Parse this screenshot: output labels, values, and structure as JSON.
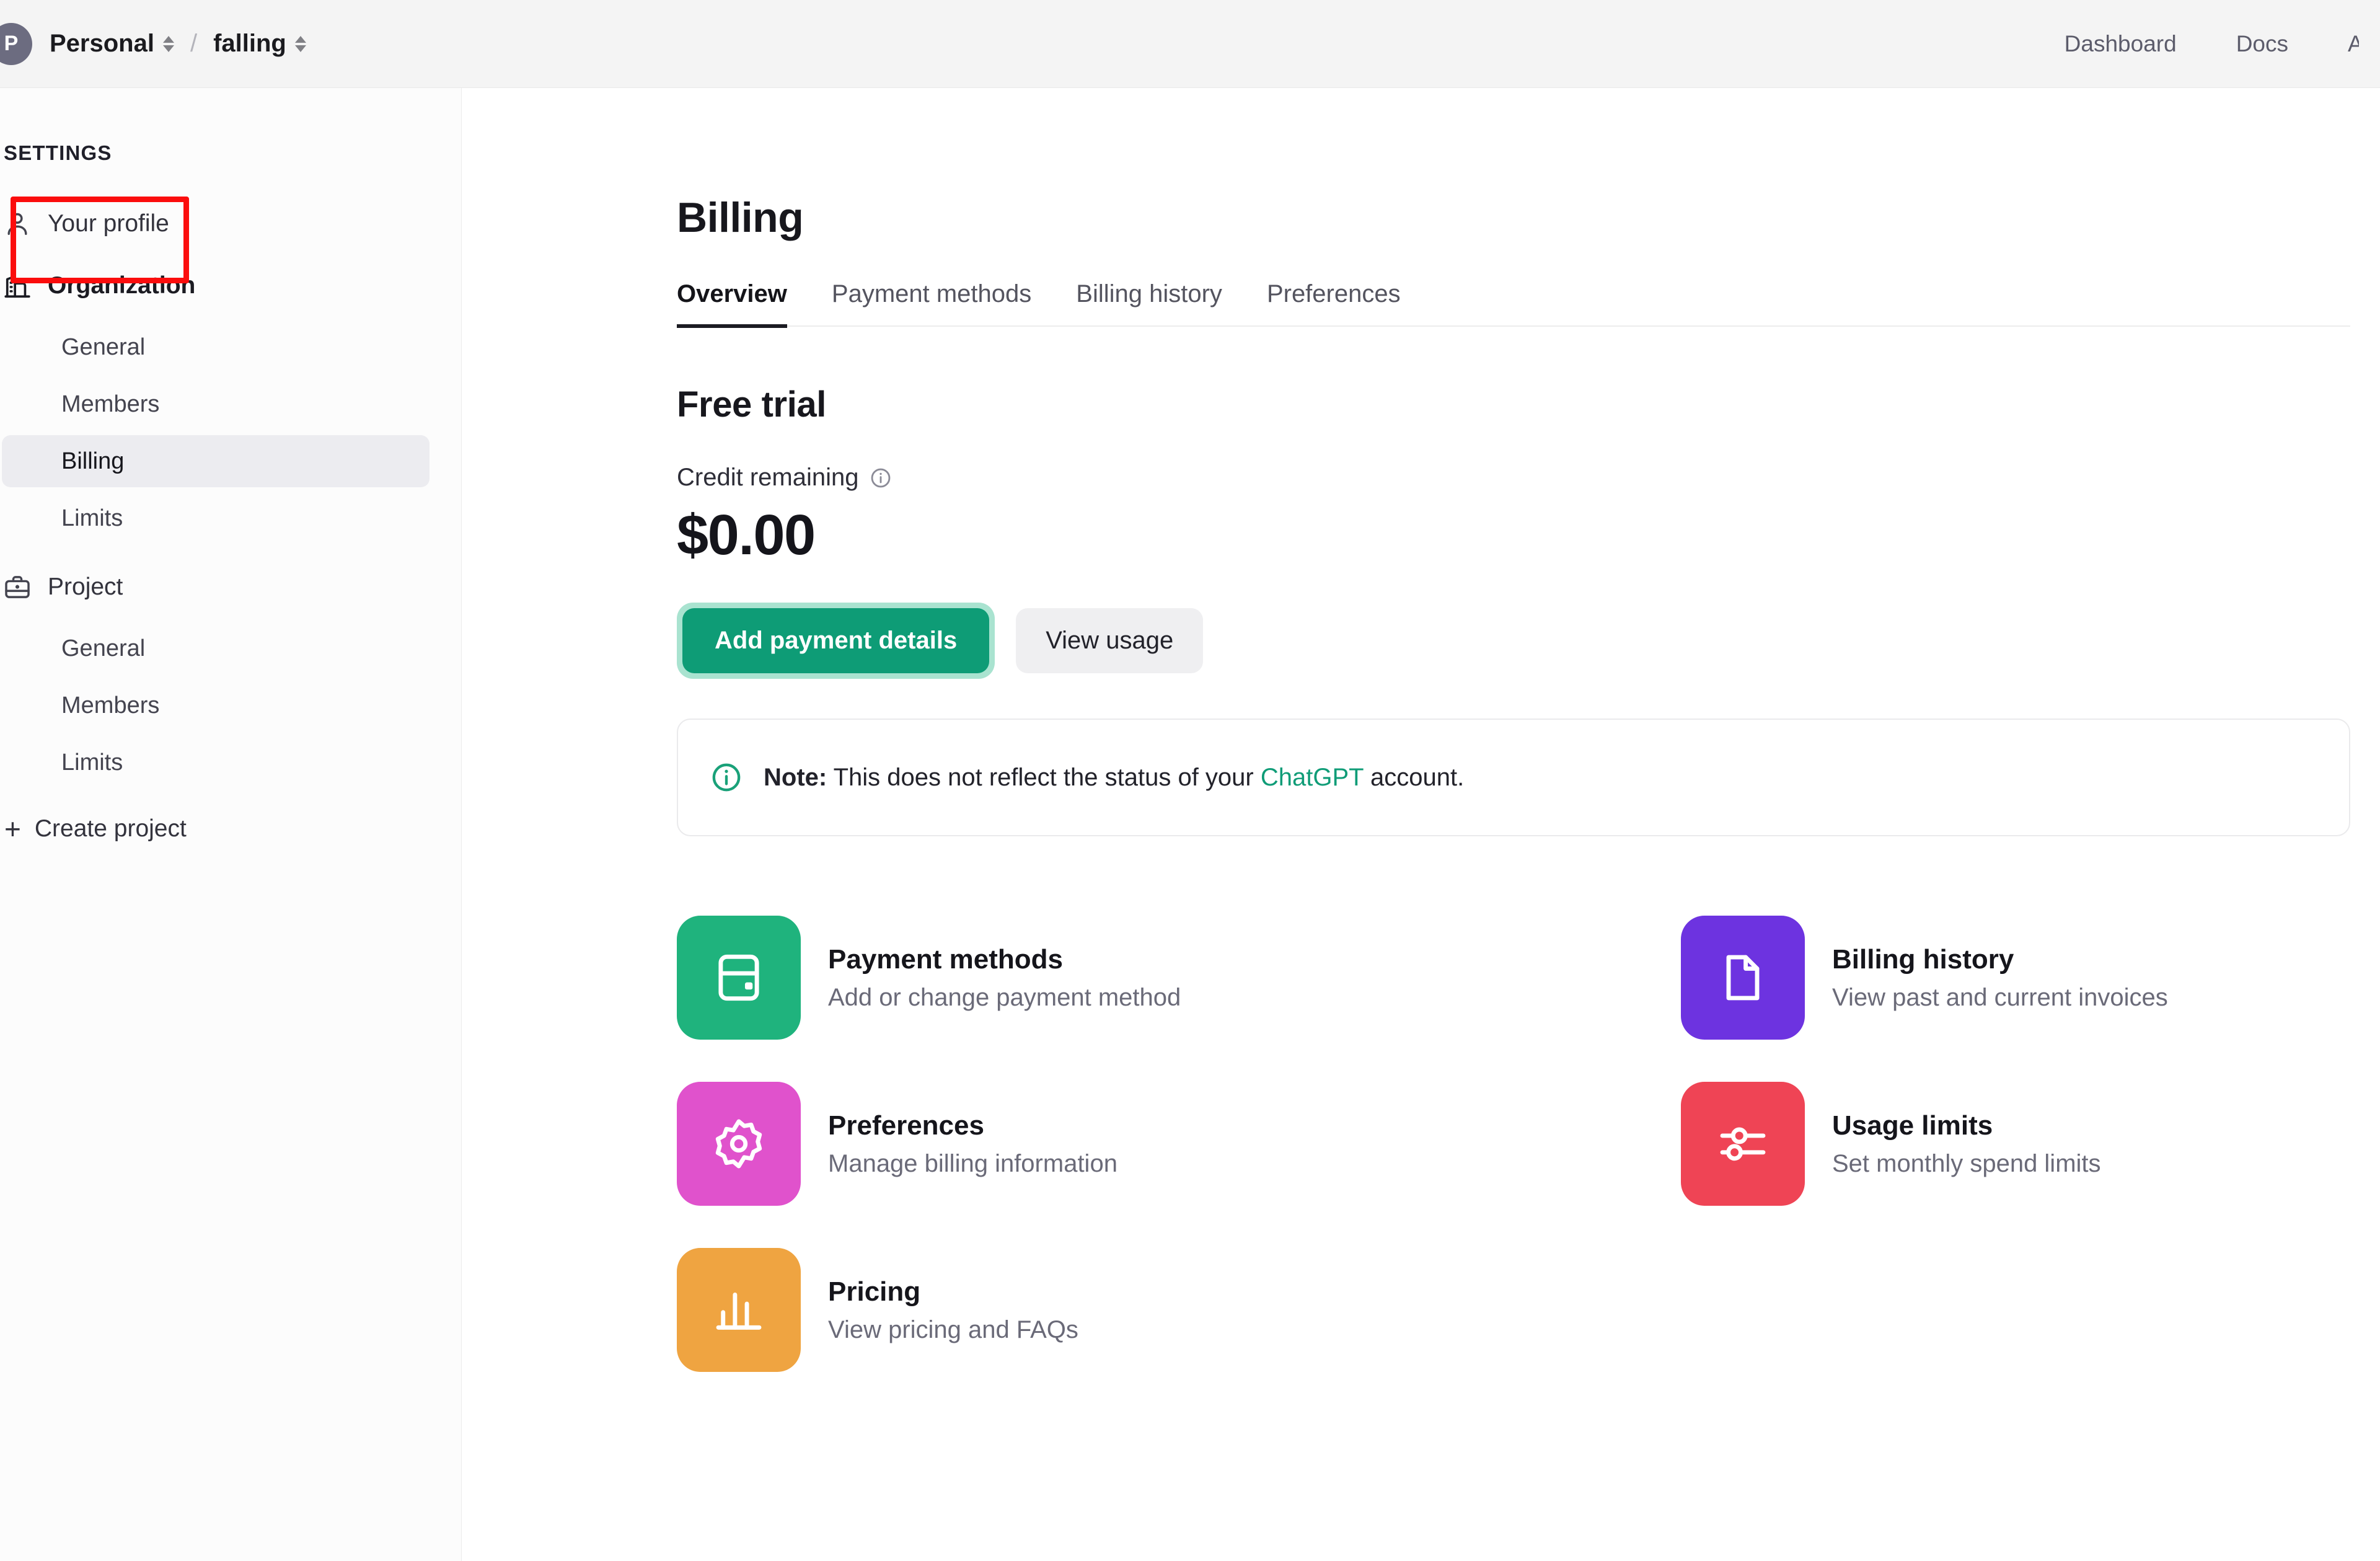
{
  "topbar": {
    "avatar_initial": "P",
    "org_name": "Personal",
    "separator": "/",
    "project_name": "falling",
    "nav": [
      {
        "label": "Dashboard",
        "name": "dashboard"
      },
      {
        "label": "Docs",
        "name": "docs"
      }
    ],
    "overflow_label": "A"
  },
  "sidebar": {
    "heading": "SETTINGS",
    "your_profile": {
      "label": "Your profile",
      "icon": "user-icon"
    },
    "organization": {
      "label": "Organization",
      "icon": "building-icon"
    },
    "org_items": [
      {
        "label": "General",
        "active": false
      },
      {
        "label": "Members",
        "active": false
      },
      {
        "label": "Billing",
        "active": true
      },
      {
        "label": "Limits",
        "active": false
      }
    ],
    "project": {
      "label": "Project",
      "icon": "briefcase-icon"
    },
    "project_items": [
      {
        "label": "General",
        "active": false
      },
      {
        "label": "Members",
        "active": false
      },
      {
        "label": "Limits",
        "active": false
      }
    ],
    "create_project": {
      "label": "Create project",
      "icon": "plus-icon"
    }
  },
  "main": {
    "page_title": "Billing",
    "tabs": [
      {
        "label": "Overview",
        "active": true
      },
      {
        "label": "Payment methods",
        "active": false
      },
      {
        "label": "Billing history",
        "active": false
      },
      {
        "label": "Preferences",
        "active": false
      }
    ],
    "plan_title": "Free trial",
    "credit_label": "Credit remaining",
    "credit_info_icon": "info-circle-icon",
    "credit_amount": "$0.00",
    "add_payment_label": "Add payment details",
    "view_usage_label": "View usage",
    "note": {
      "icon": "info-circle-icon",
      "bold_prefix": "Note:",
      "text_before": " This does not reflect the status of your ",
      "link": "ChatGPT",
      "text_after": " account."
    },
    "cards": [
      {
        "title": "Payment methods",
        "subtitle": "Add or change payment method",
        "icon": "credit-card-icon",
        "color": "#1fb37d"
      },
      {
        "title": "Billing history",
        "subtitle": "View past and current invoices",
        "icon": "document-icon",
        "color": "#6d33e0"
      },
      {
        "title": "Preferences",
        "subtitle": "Manage billing information",
        "icon": "gear-icon",
        "color": "#e052cc"
      },
      {
        "title": "Usage limits",
        "subtitle": "Set monthly spend limits",
        "icon": "sliders-icon",
        "color": "#ef4455"
      },
      {
        "title": "Pricing",
        "subtitle": "View pricing and FAQs",
        "icon": "bar-chart-icon",
        "color": "#efa441"
      }
    ]
  },
  "annotation": {
    "target": "Billing",
    "color": "#fb0d0d"
  },
  "colors": {
    "accent_green": "#0e9c76",
    "link_green": "#0f9c77",
    "annotation_red": "#fb0d0d",
    "topbar_bg": "#f4f4f4",
    "sidebar_bg": "#fcfcfc",
    "active_item_bg": "#ececf0"
  }
}
